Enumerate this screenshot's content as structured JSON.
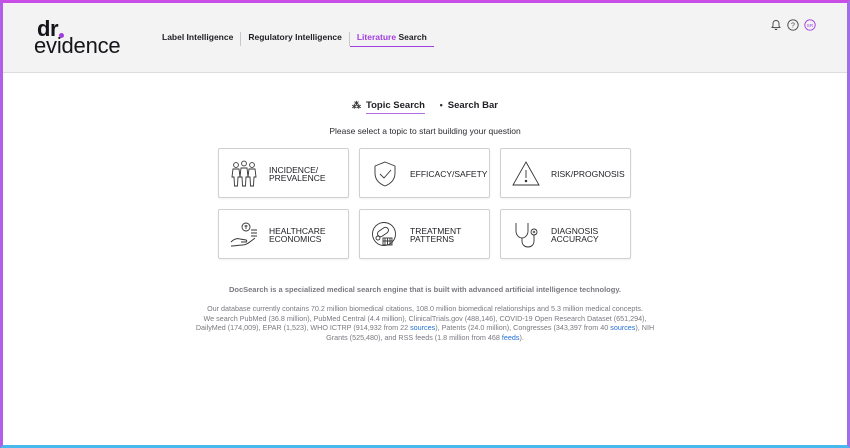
{
  "brand": {
    "logo_top": "dr",
    "logo_bottom": "evidence"
  },
  "nav": {
    "items": [
      {
        "label": "Label Intelligence"
      },
      {
        "label": "Regulatory Intelligence"
      },
      {
        "label_highlight": "Literature",
        "label_rest": " Search"
      }
    ]
  },
  "header_icons": {
    "notifications": "bell-icon",
    "help": "help-icon",
    "avatar_initials": "SR"
  },
  "tabs": {
    "topic": "Topic Search",
    "searchbar": "Search Bar",
    "topic_icon": "cluster-icon",
    "searchbar_icon": "dot-icon"
  },
  "instruction": "Please select a topic to start building your question",
  "topics": [
    {
      "label": "INCIDENCE/\nPREVALENCE",
      "icon": "people-icon"
    },
    {
      "label": "EFFICACY/SAFETY",
      "icon": "shield-check-icon"
    },
    {
      "label": "RISK/PROGNOSIS",
      "icon": "warning-icon"
    },
    {
      "label": "HEALTHCARE\nECONOMICS",
      "icon": "hand-coins-icon"
    },
    {
      "label": "TREATMENT\nPATTERNS",
      "icon": "pills-icon"
    },
    {
      "label": "DIAGNOSIS\nACCURACY",
      "icon": "stethoscope-icon"
    }
  ],
  "tagline": "DocSearch is a specialized medical search engine that is built with advanced artificial intelligence technology.",
  "stats": {
    "line1": "Our database currently contains 70.2 million biomedical citations, 108.0 million biomedical relationships and 5.3 million medical concepts.",
    "line2": "We search PubMed (36.8 million), PubMed Central (4.4 million), ClinicalTrials.gov (488,146), COVID-19 Open Research Dataset (651,294),",
    "line3a": "DailyMed (174,009), EPAR (1,523), WHO ICTRP (914,932 from 22 ",
    "link1": "sources",
    "line3b": "), Patents (24.0 million), Congresses (343,397 from 40 ",
    "link2": "sources",
    "line3c": "), NIH",
    "line4a": "Grants (525,480), and RSS feeds (1.8 million from 468 ",
    "link3": "feeds",
    "line4b": ")."
  },
  "colors": {
    "accent": "#a23ee0",
    "link": "#1f6fd6",
    "header_bg": "#f3f3f4"
  }
}
